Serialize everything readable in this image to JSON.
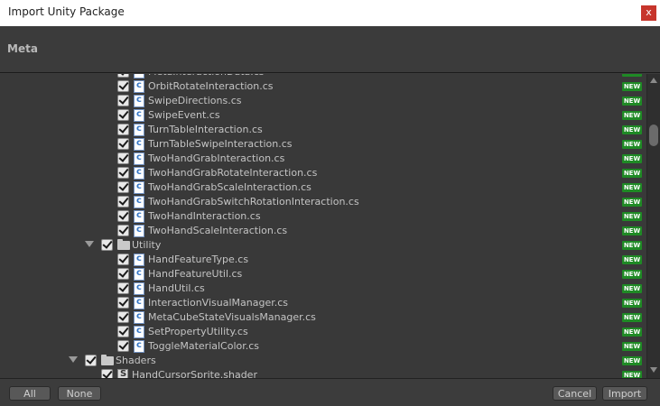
{
  "window": {
    "title": "Import Unity Package",
    "close_label": "x"
  },
  "header": {
    "title": "Meta"
  },
  "tree": {
    "rows": [
      {
        "kind": "file",
        "level": 3,
        "label": "MetaInteractionData.cs",
        "badge": "NEW"
      },
      {
        "kind": "file",
        "level": 3,
        "label": "OrbitRotateInteraction.cs",
        "badge": "NEW"
      },
      {
        "kind": "file",
        "level": 3,
        "label": "SwipeDirections.cs",
        "badge": "NEW"
      },
      {
        "kind": "file",
        "level": 3,
        "label": "SwipeEvent.cs",
        "badge": "NEW"
      },
      {
        "kind": "file",
        "level": 3,
        "label": "TurnTableInteraction.cs",
        "badge": "NEW"
      },
      {
        "kind": "file",
        "level": 3,
        "label": "TurnTableSwipeInteraction.cs",
        "badge": "NEW"
      },
      {
        "kind": "file",
        "level": 3,
        "label": "TwoHandGrabInteraction.cs",
        "badge": "NEW"
      },
      {
        "kind": "file",
        "level": 3,
        "label": "TwoHandGrabRotateInteraction.cs",
        "badge": "NEW"
      },
      {
        "kind": "file",
        "level": 3,
        "label": "TwoHandGrabScaleInteraction.cs",
        "badge": "NEW"
      },
      {
        "kind": "file",
        "level": 3,
        "label": "TwoHandGrabSwitchRotationInteraction.cs",
        "badge": "NEW"
      },
      {
        "kind": "file",
        "level": 3,
        "label": "TwoHandInteraction.cs",
        "badge": "NEW"
      },
      {
        "kind": "file",
        "level": 3,
        "label": "TwoHandScaleInteraction.cs",
        "badge": "NEW"
      },
      {
        "kind": "folder",
        "level": 2,
        "label": "Utility",
        "badge": "NEW"
      },
      {
        "kind": "file",
        "level": 3,
        "label": "HandFeatureType.cs",
        "badge": "NEW"
      },
      {
        "kind": "file",
        "level": 3,
        "label": "HandFeatureUtil.cs",
        "badge": "NEW"
      },
      {
        "kind": "file",
        "level": 3,
        "label": "HandUtil.cs",
        "badge": "NEW"
      },
      {
        "kind": "file",
        "level": 3,
        "label": "InteractionVisualManager.cs",
        "badge": "NEW"
      },
      {
        "kind": "file",
        "level": 3,
        "label": "MetaCubeStateVisualsManager.cs",
        "badge": "NEW"
      },
      {
        "kind": "file",
        "level": 3,
        "label": "SetPropertyUtility.cs",
        "badge": "NEW"
      },
      {
        "kind": "file",
        "level": 3,
        "label": "ToggleMaterialColor.cs",
        "badge": "NEW"
      },
      {
        "kind": "folder",
        "level": 1,
        "label": "Shaders",
        "badge": "NEW"
      },
      {
        "kind": "shader",
        "level": 2,
        "label": "HandCursorSprite.shader",
        "badge": "NEW"
      }
    ]
  },
  "footer": {
    "all_label": "All",
    "none_label": "None",
    "cancel_label": "Cancel",
    "import_label": "Import"
  },
  "colors": {
    "background": "#393939",
    "new_badge": "#1f8a25",
    "close_button": "#c7352c"
  }
}
